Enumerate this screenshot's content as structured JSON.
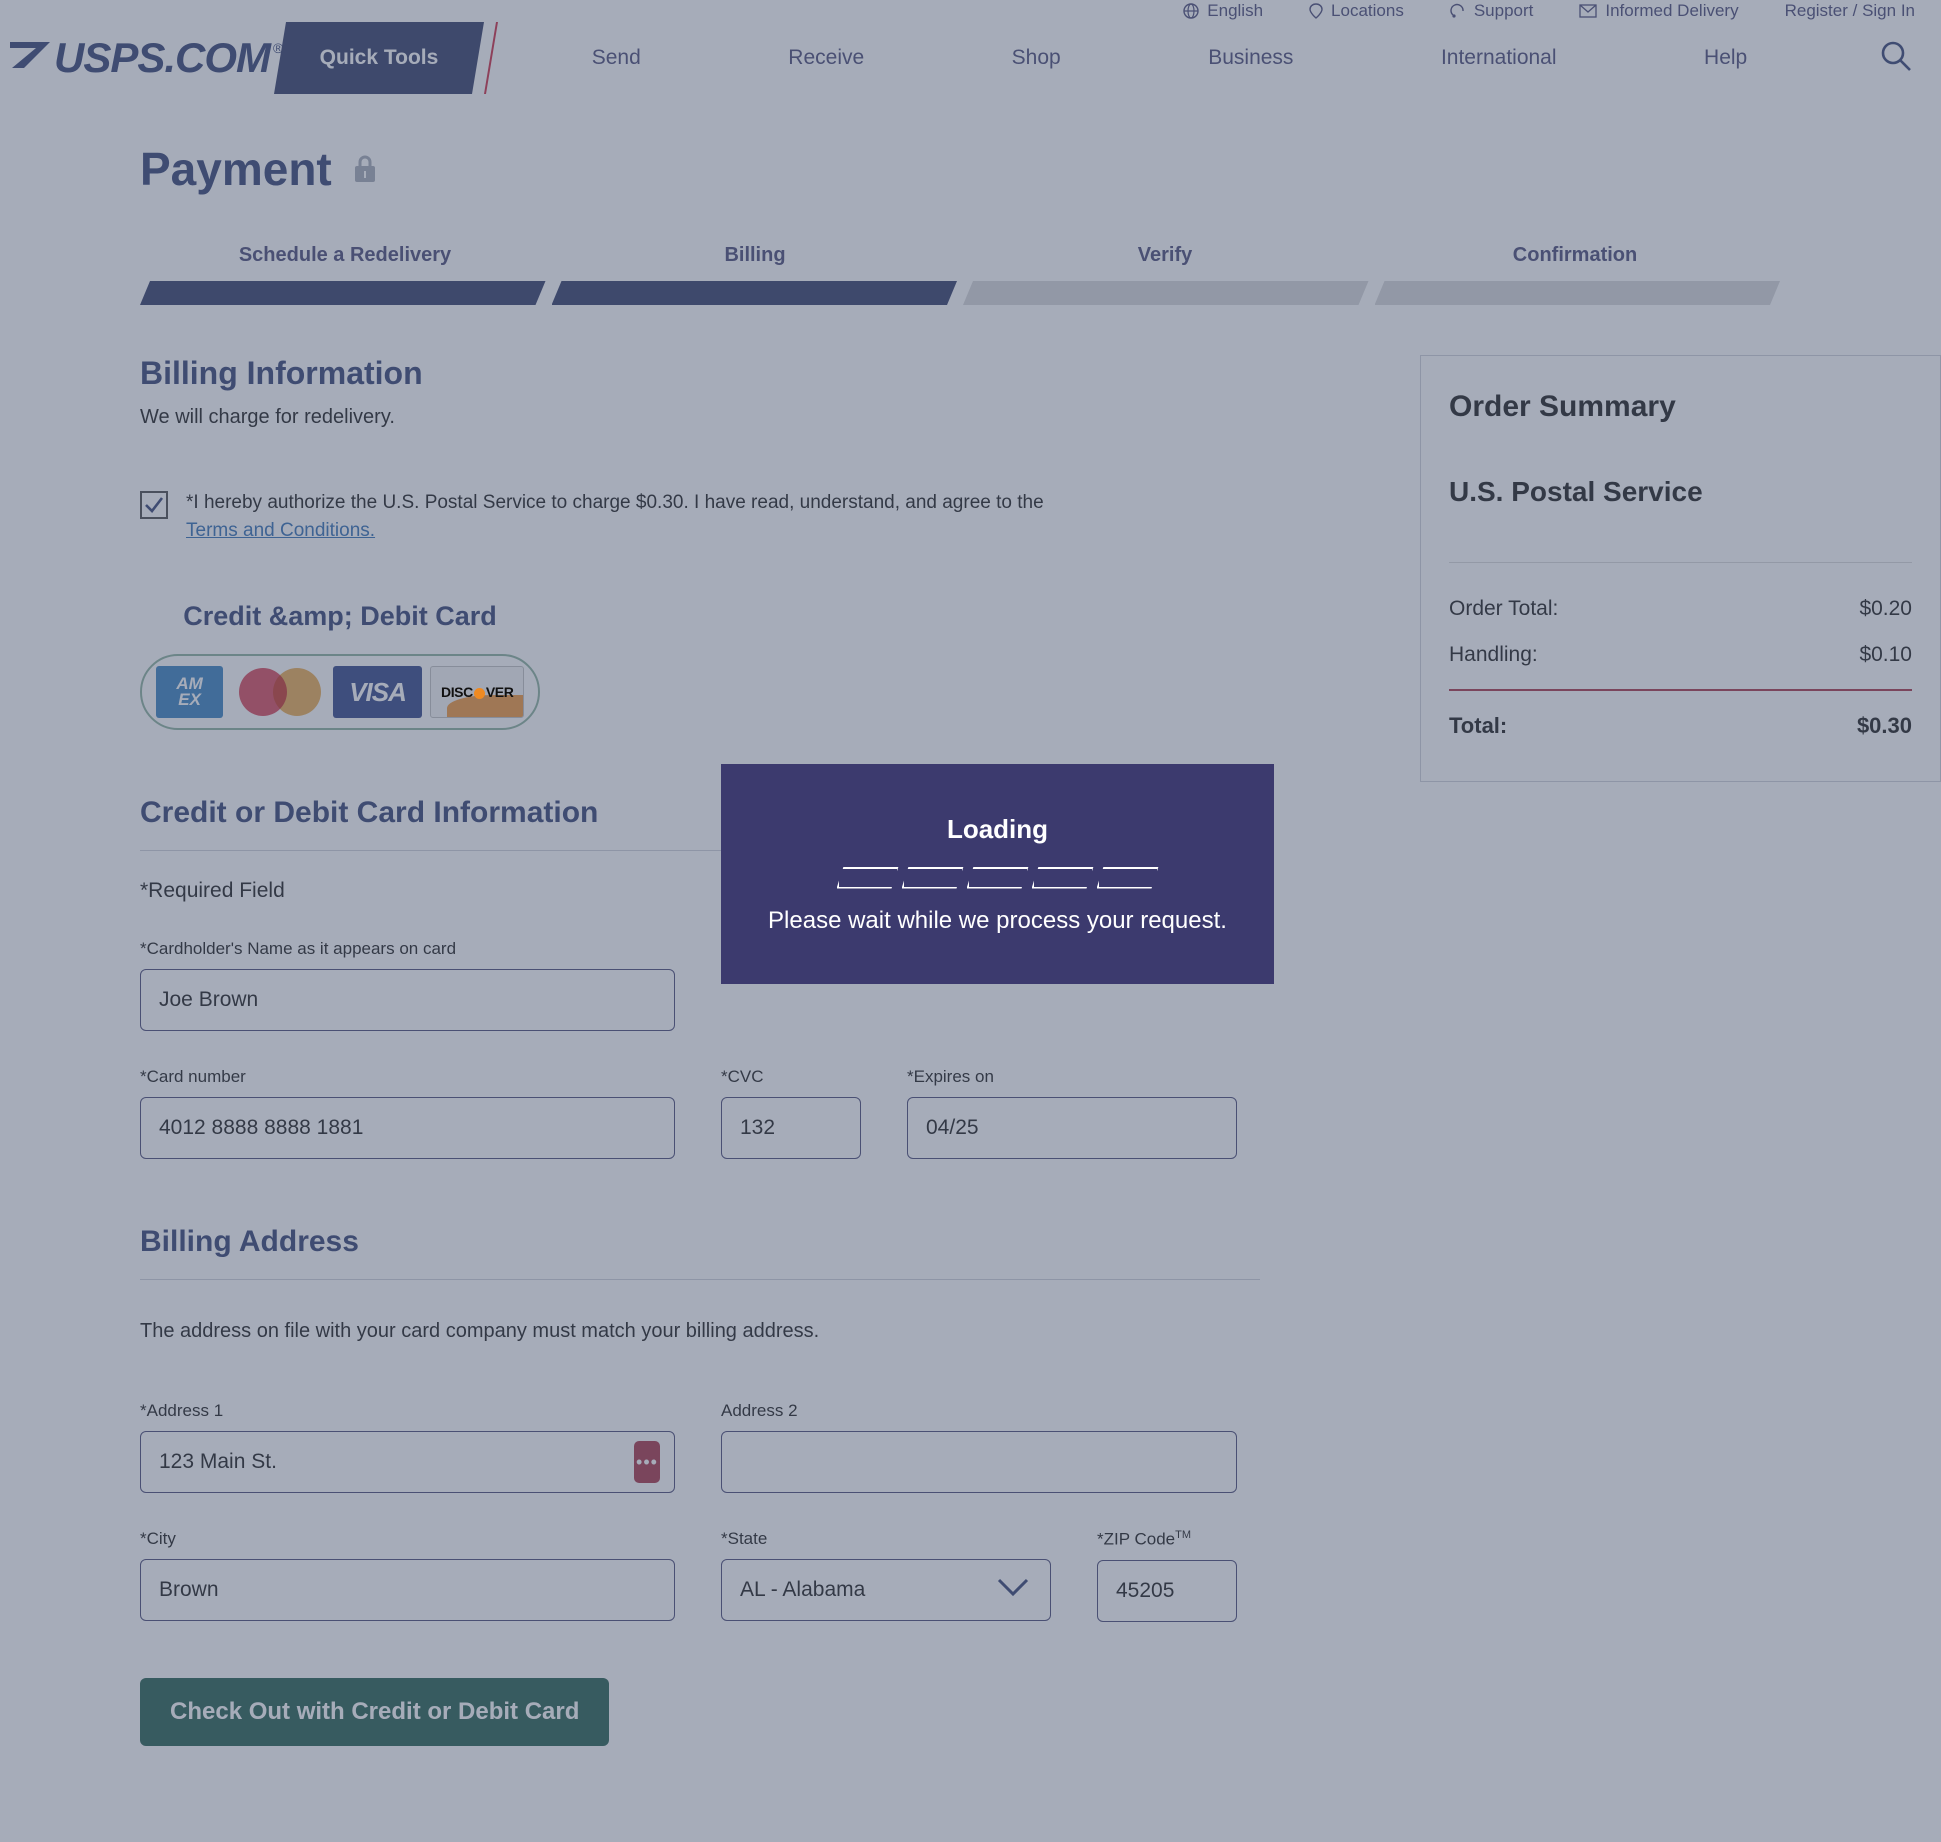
{
  "utility_nav": {
    "items": [
      {
        "label": "English",
        "icon": "globe-icon"
      },
      {
        "label": "Locations",
        "icon": "map-pin-icon"
      },
      {
        "label": "Support",
        "icon": "support-icon"
      },
      {
        "label": "Informed Delivery",
        "icon": "envelope-icon"
      },
      {
        "label": "Register / Sign In",
        "icon": "user-icon"
      }
    ]
  },
  "main_nav": {
    "logo_text": "USPS.COM",
    "logo_registered": "®",
    "quick_tools": "Quick Tools",
    "links": [
      "Send",
      "Receive",
      "Shop",
      "Business",
      "International",
      "Help"
    ],
    "search_icon": "search-icon"
  },
  "header": {
    "title": "Payment",
    "lock_icon": "lock-icon"
  },
  "stepper": {
    "steps": [
      {
        "label": "Schedule a Redelivery",
        "state": "done"
      },
      {
        "label": "Billing",
        "state": "done"
      },
      {
        "label": "Verify",
        "state": "todo"
      },
      {
        "label": "Confirmation",
        "state": "todo"
      }
    ]
  },
  "billing": {
    "heading": "Billing Information",
    "subtext": "We will charge for redelivery.",
    "auth_checked": true,
    "auth_text": "*I hereby authorize the U.S. Postal Service to charge $0.30. I have read, understand, and agree to the ",
    "auth_link": "Terms and Conditions.",
    "card_type_title": "Credit &amp; Debit Card",
    "card_brands": [
      "AMEX",
      "Mastercard",
      "VISA",
      "DISCOVER"
    ]
  },
  "card_info": {
    "heading": "Credit or Debit Card Information",
    "required_note": "*Required Field",
    "cardholder_label": "*Cardholder's Name as it appears on card",
    "cardholder_value": "Joe Brown",
    "card_number_label": "*Card number",
    "card_number_value": "4012 8888 8888 1881",
    "cvc_label": "*CVC",
    "cvc_value": "132",
    "expires_label": "*Expires on",
    "expires_value": "04/25"
  },
  "billing_address": {
    "heading": "Billing Address",
    "note": "The address on file with your card company must match your billing address.",
    "address1_label": "*Address 1",
    "address1_value": "123 Main St.",
    "address1_badge": "•••",
    "address2_label": "Address 2",
    "address2_value": "",
    "city_label": "*City",
    "city_value": "Brown",
    "state_label": "*State",
    "state_value": "AL - Alabama",
    "zip_label": "*ZIP Code",
    "zip_label_sup": "TM",
    "zip_value": "45205"
  },
  "checkout": {
    "button_label": "Check Out with Credit or Debit Card",
    "button_color": "#0b4d3a"
  },
  "order_summary": {
    "title": "Order Summary",
    "merchant": "U.S. Postal Service",
    "lines": [
      {
        "label": "Order Total:",
        "value": "$0.20"
      },
      {
        "label": "Handling:",
        "value": "$0.10"
      }
    ],
    "total_label": "Total:",
    "total_value": "$0.30",
    "rule_color": "#9e1b32"
  },
  "loading_modal": {
    "title": "Loading",
    "message": "Please wait while we process your request.",
    "segments": 5,
    "background": "#3c3a6e"
  }
}
